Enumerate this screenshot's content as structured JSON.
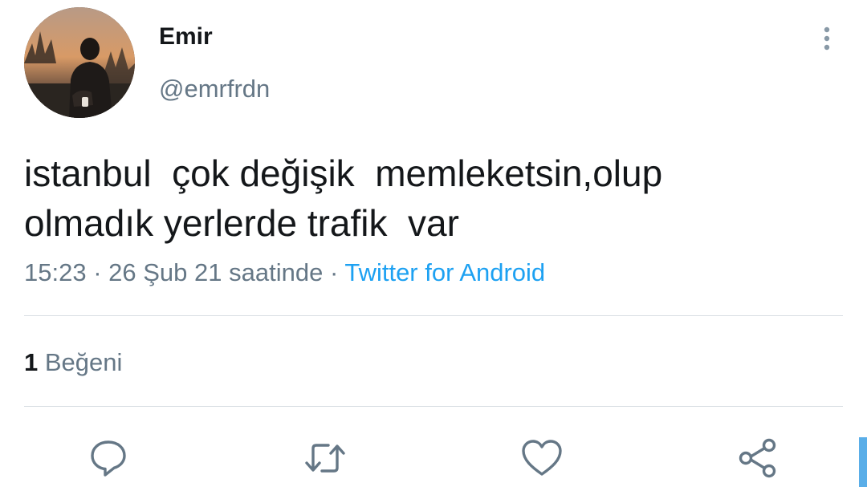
{
  "tweet": {
    "author": {
      "display_name": "Emir",
      "handle": "@emrfrdn"
    },
    "text": "istanbul  çok değişik  memleketsin,olup\nolmadık yerlerde trafik  var",
    "time": "15:23",
    "separator": "·",
    "date": "26 Şub 21 saatinde",
    "source": "Twitter for Android",
    "likes": {
      "count": "1",
      "label": "Beğeni"
    }
  },
  "icons": {
    "more": "more-vertical-icon",
    "reply": "reply-icon",
    "retweet": "retweet-icon",
    "like": "heart-icon",
    "share": "share-icon"
  },
  "colors": {
    "primary_text": "#14171a",
    "secondary_text": "#657786",
    "link": "#1da1f2",
    "icon": "#657786",
    "divider": "#d8dde2"
  }
}
